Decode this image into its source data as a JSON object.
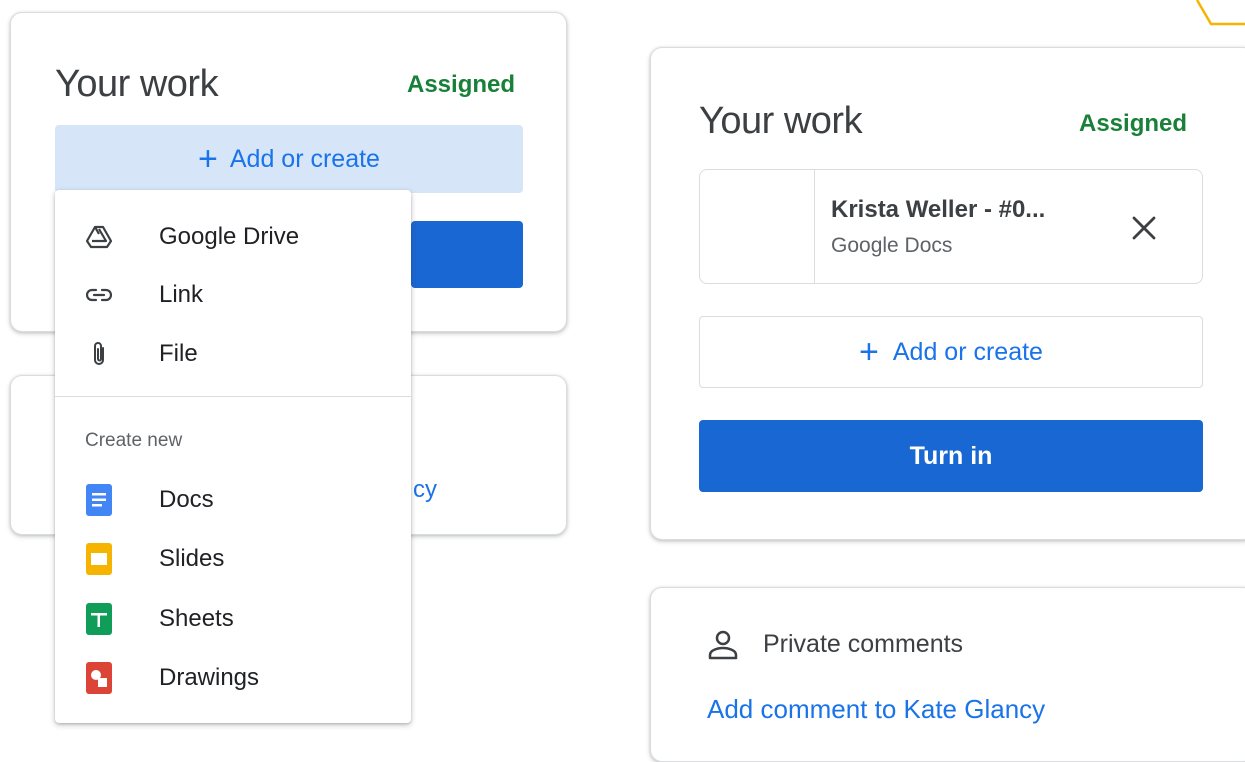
{
  "left_card": {
    "title": "Your work",
    "status": "Assigned",
    "add_button_label": "Add or create",
    "add_button_plus": "+",
    "partial_text": "cy"
  },
  "menu": {
    "items": [
      {
        "label": "Google Drive",
        "icon": "google-drive-icon"
      },
      {
        "label": "Link",
        "icon": "link-icon"
      },
      {
        "label": "File",
        "icon": "paperclip-icon"
      }
    ],
    "create_new_label": "Create new",
    "create_items": [
      {
        "label": "Docs",
        "icon": "docs-icon",
        "color": "#4285f4"
      },
      {
        "label": "Slides",
        "icon": "slides-icon",
        "color": "#f4b400"
      },
      {
        "label": "Sheets",
        "icon": "sheets-icon",
        "color": "#0f9d58"
      },
      {
        "label": "Drawings",
        "icon": "drawings-icon",
        "color": "#db4437"
      }
    ]
  },
  "right_card": {
    "title": "Your work",
    "status": "Assigned",
    "attachment": {
      "name": "Krista Weller - #0...",
      "type": "Google Docs"
    },
    "add_button_label": "Add or create",
    "add_button_plus": "+",
    "turn_in_label": "Turn in"
  },
  "comments": {
    "title": "Private comments",
    "link_label": "Add comment to Kate Glancy"
  },
  "colors": {
    "primary_blue": "#1a73e8",
    "assigned_green": "#188038",
    "button_blue": "#1967d2"
  }
}
